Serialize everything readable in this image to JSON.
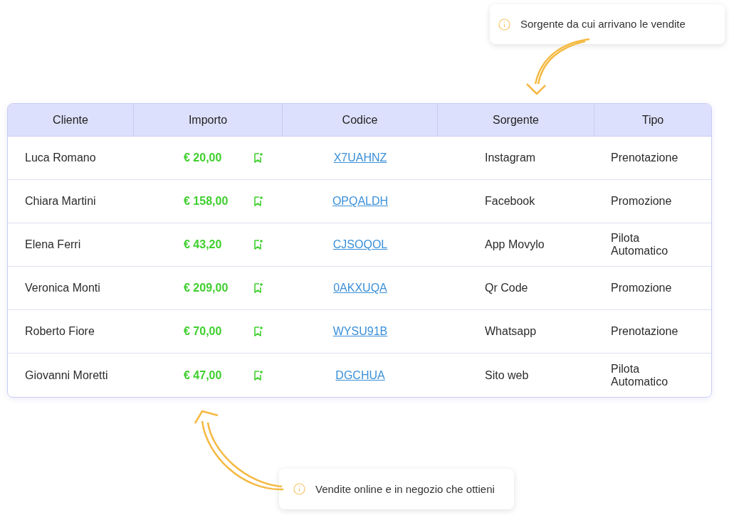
{
  "callouts": [
    {
      "text": "Sorgente da cui arrivano le vendite"
    },
    {
      "text": "Vendite online e in negozio che ottieni"
    }
  ],
  "table": {
    "columns": [
      "Cliente",
      "Importo",
      "Codice",
      "Sorgente",
      "Tipo"
    ],
    "rows": [
      {
        "cliente": "Luca Romano",
        "importo": "€ 20,00",
        "codice": "X7UAHNZ",
        "sorgente": "Instagram",
        "tipo": "Prenotazione"
      },
      {
        "cliente": "Chiara Martini",
        "importo": "€ 158,00",
        "codice": "OPQALDH",
        "sorgente": "Facebook",
        "tipo": "Promozione"
      },
      {
        "cliente": "Elena Ferri",
        "importo": "€ 43,20",
        "codice": "CJSOQOL",
        "sorgente": "App Movylo",
        "tipo": "Pilota Automatico"
      },
      {
        "cliente": "Veronica Monti",
        "importo": "€ 209,00",
        "codice": "0AKXUQA",
        "sorgente": "Qr Code",
        "tipo": "Promozione"
      },
      {
        "cliente": "Roberto Fiore",
        "importo": "€ 70,00",
        "codice": "WYSU91B",
        "sorgente": "Whatsapp",
        "tipo": "Prenotazione"
      },
      {
        "cliente": "Giovanni Moretti",
        "importo": "€ 47,00",
        "codice": "DGCHUA",
        "sorgente": "Sito web",
        "tipo": "Pilota Automatico"
      }
    ]
  }
}
